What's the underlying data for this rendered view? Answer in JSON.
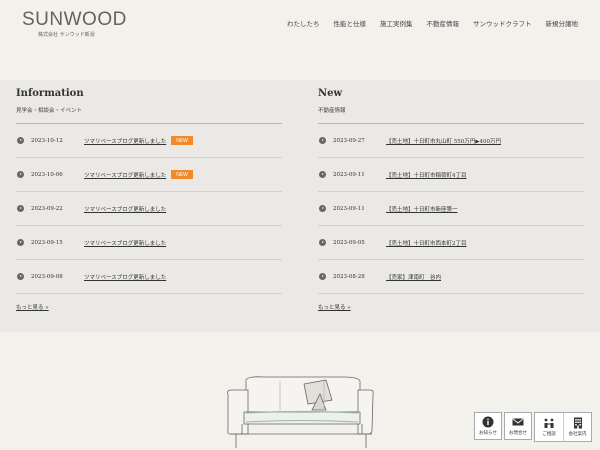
{
  "header": {
    "logo_text": "SUNWOOD",
    "logo_sub": "株式会社 サンウッド新潟",
    "nav": [
      "わたしたち",
      "性能と仕様",
      "施工実例集",
      "不動産情報",
      "サンウッドクラフト",
      "新規分譲地"
    ]
  },
  "information": {
    "title": "Information",
    "subtitle": "見学会・相談会・イベント",
    "items": [
      {
        "date": "2023-10-12",
        "title": "ツマリベースブログ更新しました",
        "badge": "NEW"
      },
      {
        "date": "2023-10-06",
        "title": "ツマリベースブログ更新しました",
        "badge": "NEW"
      },
      {
        "date": "2023-09-22",
        "title": "ツマリベースブログ更新しました",
        "badge": ""
      },
      {
        "date": "2023-09-15",
        "title": "ツマリベースブログ更新しました",
        "badge": ""
      },
      {
        "date": "2023-09-08",
        "title": "ツマリベースブログ更新しました",
        "badge": ""
      }
    ],
    "more": "もっと見る »"
  },
  "new": {
    "title": "New",
    "subtitle": "不動産情報",
    "items": [
      {
        "date": "2023-09-27",
        "title": "【売土地】十日町市丸山町 550万円▶400万円"
      },
      {
        "date": "2023-09-11",
        "title": "【売土地】十日町市稲荷町4丁目"
      },
      {
        "date": "2023-09-11",
        "title": "【売土地】十日町市新座第一"
      },
      {
        "date": "2023-09-05",
        "title": "【売土地】十日町市西本町2丁目"
      },
      {
        "date": "2023-08-28",
        "title": "【売家】津南町　谷内"
      }
    ],
    "more": "もっと見る »"
  },
  "fabs": {
    "news": "お知らせ",
    "contact": "お問合せ",
    "consult": "ご相談",
    "company": "会社案内"
  },
  "colors": {
    "accent": "#f08a2b",
    "background": "#f3f1ec",
    "panel": "#ebe9e5"
  }
}
